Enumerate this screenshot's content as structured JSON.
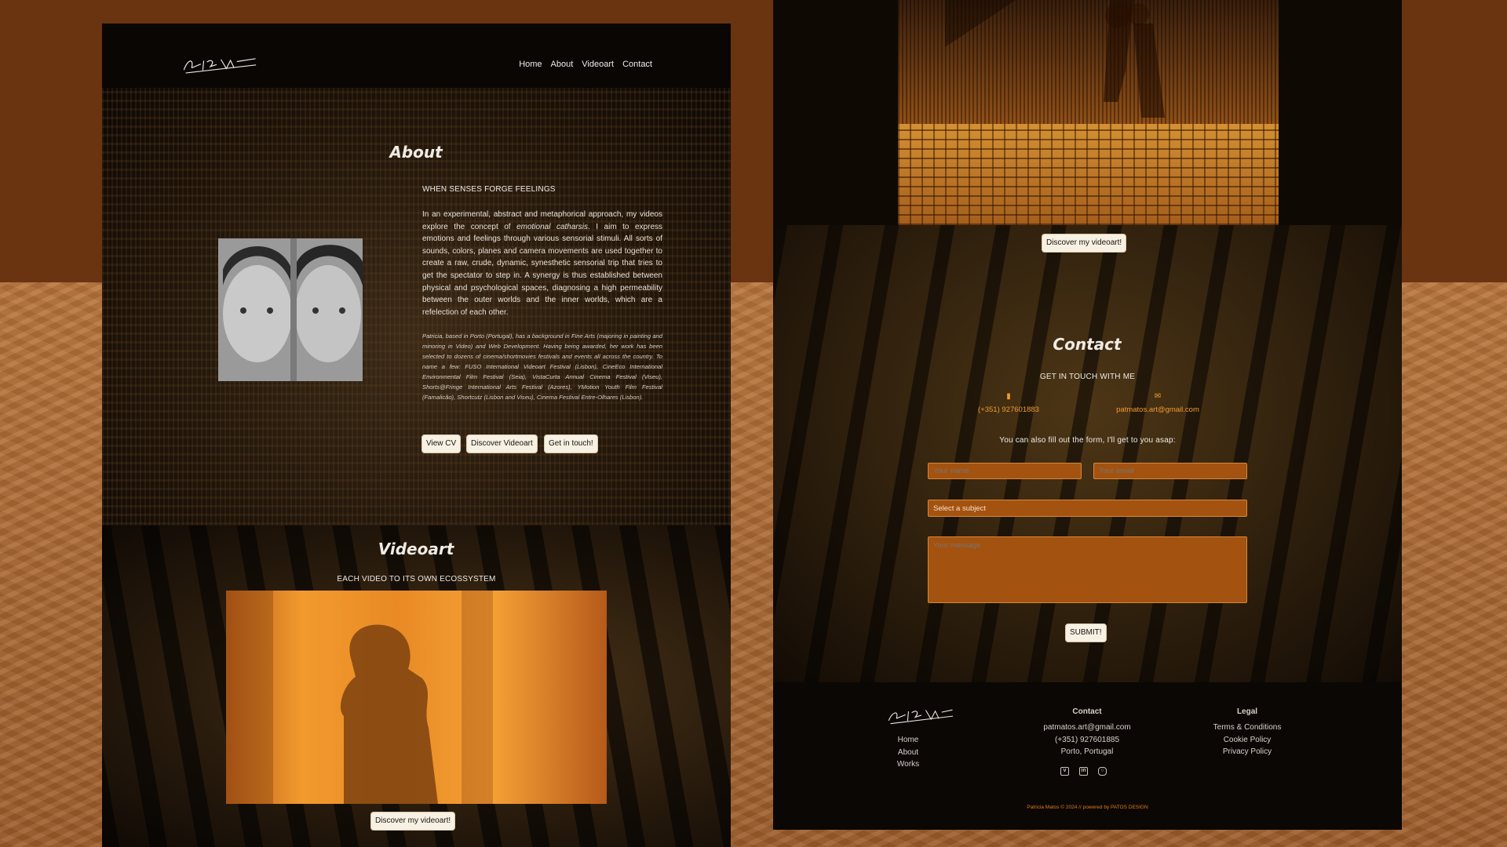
{
  "colors": {
    "accent": "#f29a2e",
    "panel": "#0f0904",
    "button_bg": "#f7f1e4",
    "field_bg": "#a4520f"
  },
  "brand": {
    "logo_text": "Patricia Matos"
  },
  "nav": {
    "items": [
      "Home",
      "About",
      "Videoart",
      "Contact"
    ]
  },
  "about": {
    "title": "About",
    "subtitle": "WHEN SENSES FORGE FEELINGS",
    "para_before": "In an experimental, abstract and metaphorical approach, my videos explore the concept of ",
    "para_emphasis": "emotional catharsis",
    "para_after": ". I aim to express emotions and feelings through various sensorial stimuli. All sorts of sounds, colors, planes and camera movements are used together to create a raw, crude, dynamic, synesthetic sensorial trip that tries to get the spectator to step in. A synergy is thus established between physical and psychological spaces, diagnosing a high permeability between the outer worlds and the inner worlds, which are a refelection of each other.",
    "bio": "Patricia, based in Porto (Portugal), has a background in Fine Arts (majoring in painting and minoring in Video) and Web Development. Having being awarded, her work has been selected to dozens of cinema/shortmovies festivals and events all across the country. To name a few: FUSO International Videoart Festival (Lisbon), CineEco International Environmental Film Festival (Seia), VistaCurta Annual Cinema Festival (Viseu), Shorts@Fringe International Arts Festival (Azores), YMotion Youth Film Festival (Famalicão), Shortcutz (Lisbon and Viseu), Cinema Festival Entre-Olhares (Lisbon).",
    "buttons": {
      "cv": "View CV",
      "videoart": "Discover Videoart",
      "contact": "Get in touch!"
    }
  },
  "videoart": {
    "title": "Videoart",
    "subtitle": "EACH VIDEO TO ITS OWN ECOSSYSTEM",
    "button": "Discover my videoart!"
  },
  "street_section": {
    "button": "Discover my videoart!"
  },
  "contact": {
    "title": "Contact",
    "subtitle": "GET IN TOUCH WITH ME",
    "phone": "(+351) 927601883",
    "email": "patmatos.art@gmail.com",
    "form_intro": "You can also fill out the form, I'll get to you asap:",
    "name_placeholder": "Your name",
    "email_placeholder": "Your email",
    "subject_selected": "Select a subject",
    "message_placeholder": "Your message",
    "submit": "SUBMIT!"
  },
  "footer": {
    "nav": [
      "Home",
      "About",
      "Works"
    ],
    "contact_heading": "Contact",
    "contact_email": "patmatos.art@gmail.com",
    "contact_phone": "(+351) 927601885",
    "contact_location": "Porto, Portugal",
    "legal_heading": "Legal",
    "legal_links": [
      "Terms & Conditions",
      "Cookie Policy",
      "Privacy Policy"
    ],
    "social_icons": [
      "vimeo-icon",
      "linkedin-icon",
      "instagram-icon"
    ],
    "credit": "Patricia Matos © 2024 // powered by PATOS DESIGN"
  }
}
